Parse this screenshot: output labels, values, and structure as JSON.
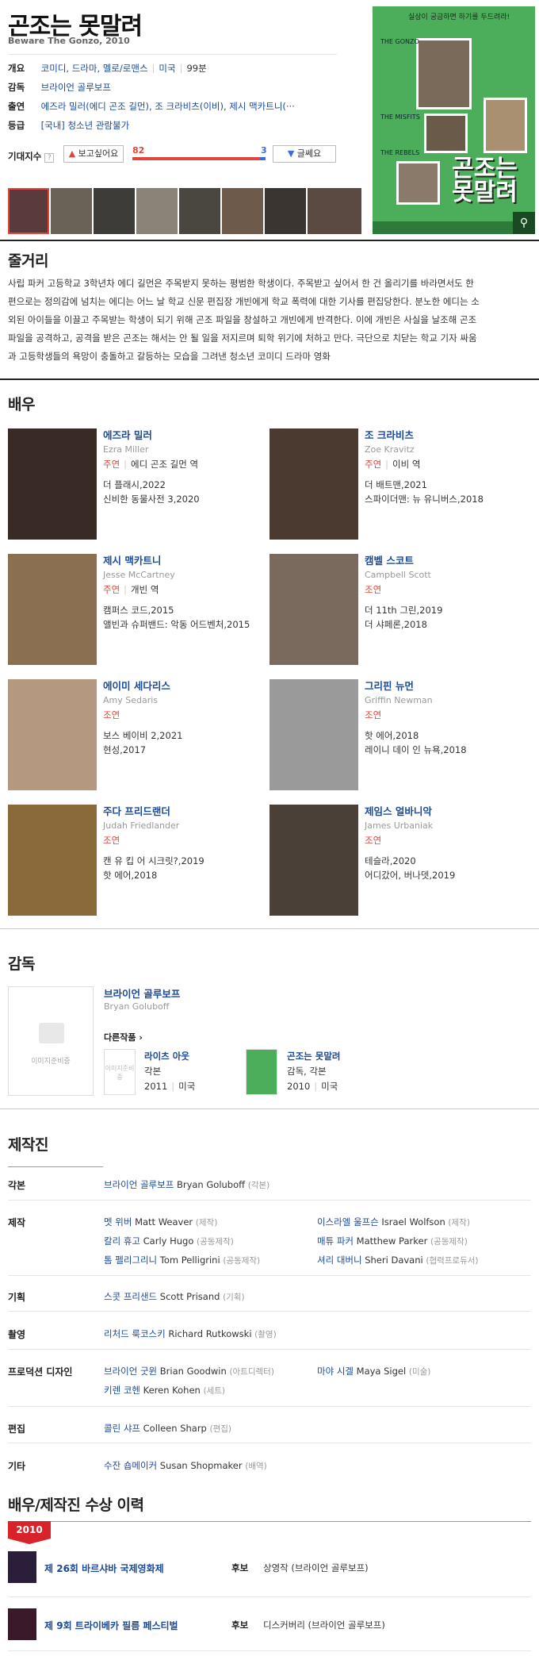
{
  "header": {
    "title": "곤조는 못말려",
    "subtitle": "Beware The Gonzo, 2010",
    "overview_label": "개요",
    "genres": "코미디, 드라마, 멜로/로맨스",
    "country": "미국",
    "runtime": "99분",
    "director_label": "감독",
    "director": "브라이언 골루보프",
    "cast_label": "출연",
    "cast": "에즈라 밀러(에디 곤조 길먼), 조 크라비츠(이비), 제시 맥카트니(···",
    "rating_label": "등급",
    "rating": "[국내] 청소년 관람불가",
    "expect_label": "기대지수",
    "want_button": "보고싶어요",
    "want_count": "82",
    "comment_count": "3",
    "comment_button": "글쎄요"
  },
  "poster": {
    "top_text": "실상이 궁금하면 하기를 두드려라!",
    "tag1": "THE GONZO",
    "tag2": "THE MISFITS",
    "tag3": "THE REBELS",
    "title_text": "곤조는 못말려",
    "release": "GONZO"
  },
  "synopsis": {
    "heading": "줄거리",
    "lines": [
      "사립 파커 고등학교 3학년차 에디 길먼은 주목받지 못하는 평범한 학생이다. 주목받고 싶어서 한 건 올리기를 바라면서도 한",
      "편으로는 정의감에 넘치는 에디는 어느 날 학교 신문 편집장 개빈에게 학교 폭력에 대한 기사를 편집당한다. 분노한 에디는 소",
      "외된 아이들을 이끌고 주목받는 학생이 되기 위해 곤조 파일을 창설하고 개빈에게 반격한다. 이에 개빈은 사실을 날조해 곤조",
      "파일을 공격하고, 공격을 받은 곤조는 해서는 안 될 일을 저지르며 퇴학 위기에 처하고 만다. 극단으로 치닫는 학교 기자 싸움",
      "과 고등학생들의 욕망이 충돌하고 갈등하는 모습을 그려낸 청소년 코미디 드라마 영화"
    ]
  },
  "actors": {
    "heading": "배우",
    "items": [
      {
        "name": "에즈라 밀러",
        "en": "Ezra Miller",
        "type": "주연",
        "role": "에디 곤조 길먼 역",
        "w1": "더 플래시,2022",
        "w2": "신비한 동물사전 3,2020"
      },
      {
        "name": "조 크라비츠",
        "en": "Zoe Kravitz",
        "type": "주연",
        "role": "이비 역",
        "w1": "더 배트맨,2021",
        "w2": "스파이더맨: 뉴 유니버스,2018"
      },
      {
        "name": "제시 맥카트니",
        "en": "Jesse McCartney",
        "type": "주연",
        "role": "개빈 역",
        "w1": "캠퍼스 코드,2015",
        "w2": "앨빈과 슈퍼밴드: 악동 어드벤처,2015"
      },
      {
        "name": "캠벨 스코트",
        "en": "Campbell Scott",
        "type": "조연",
        "role": "",
        "w1": "더 11th 그린,2019",
        "w2": "더 샤페론,2018"
      },
      {
        "name": "에이미 세다리스",
        "en": "Amy Sedaris",
        "type": "조연",
        "role": "",
        "w1": "보스 베이비 2,2021",
        "w2": "현성,2017"
      },
      {
        "name": "그리핀 뉴먼",
        "en": "Griffin Newman",
        "type": "조연",
        "role": "",
        "w1": "핫 에어,2018",
        "w2": "레이니 데이 인 뉴욕,2018"
      },
      {
        "name": "주다 프리드랜더",
        "en": "Judah Friedlander",
        "type": "조연",
        "role": "",
        "w1": "캔 유 킵 어 시크릿?,2019",
        "w2": "핫 에어,2018"
      },
      {
        "name": "제임스 얼바니악",
        "en": "James Urbaniak",
        "type": "조연",
        "role": "",
        "w1": "테슬라,2020",
        "w2": "어디갔어, 버나뎃,2019"
      }
    ]
  },
  "director": {
    "heading": "감독",
    "no_image": "이미지준비중",
    "name": "브라이언 골루보프",
    "en": "Bryan Goluboff",
    "other_works": "다른작품",
    "works": [
      {
        "title": "라이츠 아웃",
        "role": "각본",
        "year": "2011",
        "country": "미국",
        "img": "이미지준비중"
      },
      {
        "title": "곤조는 못말려",
        "role": "감독, 각본",
        "year": "2010",
        "country": "미국"
      }
    ]
  },
  "crew": {
    "heading": "제작진",
    "script_label": "각본",
    "script": {
      "name": "브라이언 골루보프",
      "en": "Bryan Goluboff",
      "role": "(각본)"
    },
    "produce_label": "제작",
    "producers": [
      {
        "name": "멧 위버",
        "en": "Matt Weaver",
        "role": "(제작)"
      },
      {
        "name": "이스라엘 울프슨",
        "en": "Israel Wolfson",
        "role": "(제작)"
      },
      {
        "name": "칼리 휴고",
        "en": "Carly Hugo",
        "role": "(공동제작)"
      },
      {
        "name": "매튜 파커",
        "en": "Matthew Parker",
        "role": "(공동제작)"
      },
      {
        "name": "톰 펠리그리니",
        "en": "Tom Pelligrini",
        "role": "(공동제작)"
      },
      {
        "name": "셔리 대버니",
        "en": "Sheri Davani",
        "role": "(협력프로듀서)"
      }
    ],
    "plan_label": "기획",
    "plan": {
      "name": "스콧 프리샌드",
      "en": "Scott Prisand",
      "role": "(기획)"
    },
    "photo_label": "촬영",
    "photo": {
      "name": "리처드 룩코스키",
      "en": "Richard Rutkowski",
      "role": "(촬영)"
    },
    "design_label": "프로덕션 디자인",
    "design": [
      {
        "name": "브라이언 굿윈",
        "en": "Brian Goodwin",
        "role": "(아트디렉터)"
      },
      {
        "name": "마야 시겔",
        "en": "Maya Sigel",
        "role": "(미술)"
      },
      {
        "name": "키렌 코헨",
        "en": "Keren Kohen",
        "role": "(세트)"
      }
    ],
    "edit_label": "편집",
    "edit": {
      "name": "콜린 샤프",
      "en": "Colleen Sharp",
      "role": "(편집)"
    },
    "etc_label": "기타",
    "etc": {
      "name": "수잔 숍메이커",
      "en": "Susan Shopmaker",
      "role": "(배역)"
    }
  },
  "awards": {
    "heading": "배우/제작진 수상 이력",
    "year": "2010",
    "items": [
      {
        "festival": "제 26회 바르샤바 국제영화제",
        "status": "후보",
        "prize": "상영작 (브라이언 골루보프)"
      },
      {
        "festival": "제 9회 트라이베카 필름 페스티벌",
        "status": "후보",
        "prize": "디스커버리 (브라이언 골루보프)"
      }
    ]
  }
}
